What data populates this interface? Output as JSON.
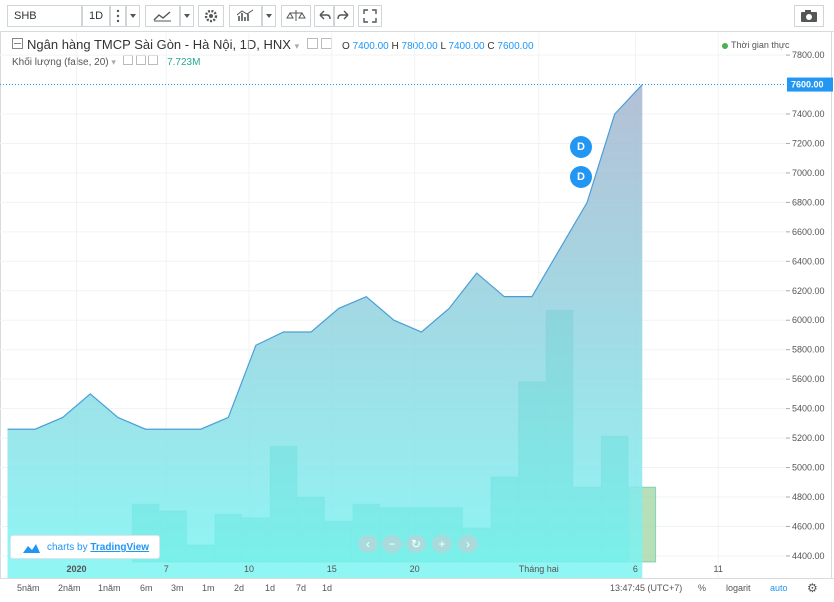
{
  "toolbar": {
    "symbol": "SHB",
    "interval": "1D"
  },
  "legend": {
    "title": "Ngân hàng TMCP Sài Gòn - Hà Nội, 1D, HNX",
    "o_label": "O",
    "o_value": "7400.00",
    "h_label": "H",
    "h_value": "7800.00",
    "l_label": "L",
    "l_value": "7400.00",
    "c_label": "C",
    "c_value": "7600.00",
    "volume_label": "Khối lượng (false, 20)",
    "volume_value": "7.723M",
    "realtime": "Thời gian thực"
  },
  "events": [
    "D",
    "D"
  ],
  "branding": {
    "prefix": "charts by",
    "name": "TradingView"
  },
  "bottom": {
    "ranges": [
      "5năm",
      "2năm",
      "1năm",
      "6m",
      "3m",
      "1m",
      "2d",
      "1d",
      "7d",
      "1d"
    ],
    "time": "13:47:45 (UTC+7)",
    "percent": "%",
    "log": "logarit",
    "auto": "auto"
  },
  "colors": {
    "line": "#4a9fd8",
    "area_top": "#a7b5cf",
    "area_bottom": "#7bf5f2",
    "volume": "#3fd6b5",
    "volume_last": "#9fd6a0",
    "price_label": "#2196f3"
  },
  "chart_data": {
    "type": "area",
    "last_price_label": "7600.00",
    "y_ticks": [
      4400,
      4600,
      4800,
      5000,
      5200,
      5400,
      5600,
      5800,
      6000,
      6200,
      6400,
      6600,
      6800,
      7000,
      7200,
      7400,
      7800
    ],
    "x_ticks": [
      {
        "label": "2020",
        "index": 2.5
      },
      {
        "label": "7",
        "index": 5.75
      },
      {
        "label": "10",
        "index": 8.75
      },
      {
        "label": "15",
        "index": 11.75
      },
      {
        "label": "20",
        "index": 14.75
      },
      {
        "label": "Tháng hai",
        "index": 19.25
      },
      {
        "label": "6",
        "index": 22.75
      },
      {
        "label": "11",
        "index": 25.75
      }
    ],
    "ylim": [
      4250,
      7950
    ],
    "close": [
      5260,
      5260,
      5340,
      5500,
      5340,
      5260,
      5260,
      5260,
      5340,
      5830,
      5920,
      5920,
      6080,
      6160,
      6000,
      5920,
      6080,
      6320,
      6160,
      6160,
      6480,
      6800,
      7400,
      7600
    ],
    "volume_relative": [
      0.17,
      0.15,
      0.05,
      0.14,
      0.13,
      0.34,
      0.19,
      0.12,
      0.17,
      0.16,
      0.16,
      0.16,
      0.1,
      0.25,
      0.53,
      0.74,
      0.22,
      0.37,
      0.22
    ]
  }
}
